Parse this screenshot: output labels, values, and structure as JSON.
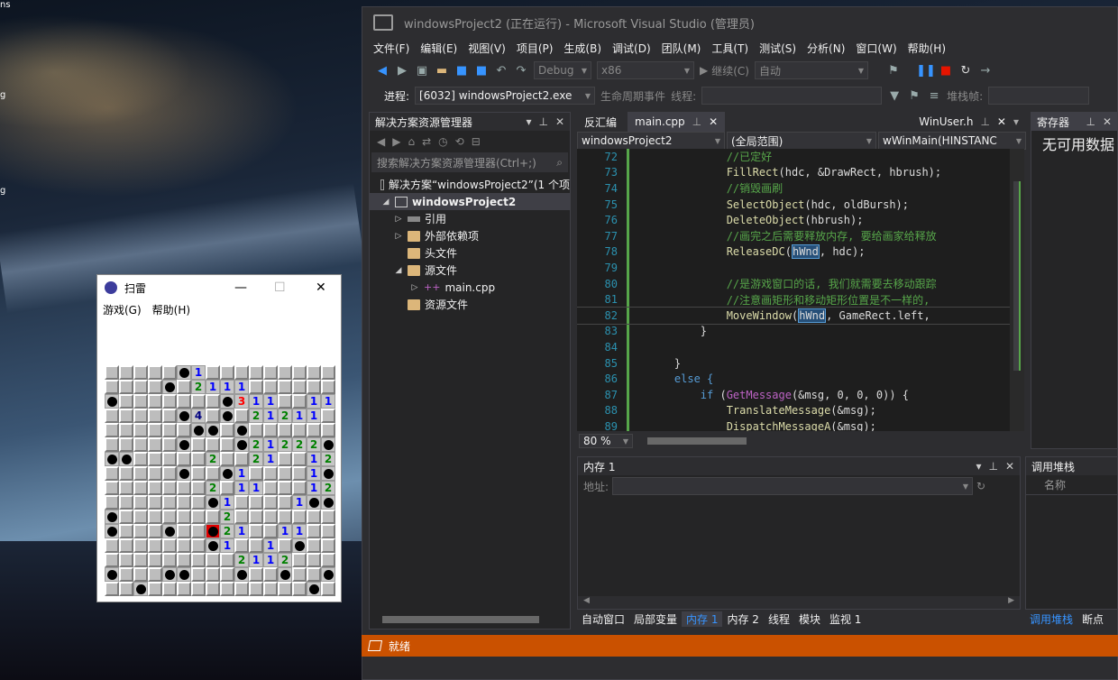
{
  "desktop": {
    "labels": [
      "ns",
      "ib",
      "g",
      "g"
    ]
  },
  "vs": {
    "title": "windowsProject2 (正在运行) - Microsoft Visual Studio (管理员)",
    "menu": [
      "文件(F)",
      "编辑(E)",
      "视图(V)",
      "项目(P)",
      "生成(B)",
      "调试(D)",
      "团队(M)",
      "工具(T)",
      "测试(S)",
      "分析(N)",
      "窗口(W)",
      "帮助(H)"
    ],
    "toolbar": {
      "config": "Debug",
      "platform": "x86",
      "continue": "继续(C)",
      "auto": "自动"
    },
    "toolbar2": {
      "process_label": "进程:",
      "process": "[6032] windowsProject2.exe",
      "lifecycle": "生命周期事件",
      "thread": "线程:",
      "stack": "堆栈帧:"
    },
    "solution_explorer": {
      "title": "解决方案资源管理器",
      "search_placeholder": "搜索解决方案资源管理器(Ctrl+;)",
      "items": [
        {
          "label": "解决方案“windowsProject2”(1 个项"
        },
        {
          "label": "windowsProject2"
        },
        {
          "label": "引用"
        },
        {
          "label": "外部依赖项"
        },
        {
          "label": "头文件"
        },
        {
          "label": "源文件"
        },
        {
          "label": "main.cpp"
        },
        {
          "label": "资源文件"
        }
      ]
    },
    "editor": {
      "tabs": [
        "反汇编",
        "main.cpp",
        "WinUser.h"
      ],
      "nav": [
        "windowsProject2",
        "(全局范围)",
        "wWinMain(HINSTANC"
      ],
      "zoom": "80 %",
      "lines": [
        {
          "n": "72",
          "t": "            //已定好"
        },
        {
          "n": "73",
          "t": "            FillRect(hdc, &DrawRect, hbrush);"
        },
        {
          "n": "74",
          "t": "            //销毁画刷"
        },
        {
          "n": "75",
          "t": "            SelectObject(hdc, oldBursh);"
        },
        {
          "n": "76",
          "t": "            DeleteObject(hbrush);"
        },
        {
          "n": "77",
          "t": "            //画完之后需要释放内存, 要给画家给释放"
        },
        {
          "n": "78",
          "t": "            ReleaseDC(hWnd, hdc);"
        },
        {
          "n": "79",
          "t": ""
        },
        {
          "n": "80",
          "t": "            //是游戏窗口的话, 我们就需要去移动跟踪"
        },
        {
          "n": "81",
          "t": "            //注意画矩形和移动矩形位置是不一样的,"
        },
        {
          "n": "82",
          "t": "            MoveWindow(hWnd, GameRect.left,"
        },
        {
          "n": "83",
          "t": "        }"
        },
        {
          "n": "84",
          "t": ""
        },
        {
          "n": "85",
          "t": "    }"
        },
        {
          "n": "86",
          "t": "    else {"
        },
        {
          "n": "87",
          "t": "        if (GetMessage(&msg, 0, 0, 0)) {"
        },
        {
          "n": "88",
          "t": "            TranslateMessage(&msg);"
        },
        {
          "n": "89",
          "t": "            DispatchMessageA(&msg);"
        }
      ]
    },
    "registers": {
      "title": "寄存器",
      "empty": "无可用数据"
    },
    "memory": {
      "title": "内存 1",
      "address_label": "地址:"
    },
    "callstack": {
      "title": "调用堆栈",
      "col": "名称"
    },
    "bottom_tabs": [
      "自动窗口",
      "局部变量",
      "内存 1",
      "内存 2",
      "线程",
      "模块",
      "监视 1"
    ],
    "bottom_tabs_right": [
      "调用堆栈",
      "断点"
    ],
    "status": "就绪"
  },
  "minesweeper": {
    "title": "扫雷",
    "menu": [
      "游戏(G)",
      "帮助(H)"
    ],
    "rows": [
      "_____m1_________",
      "____m_2111______",
      "m_______m311__11",
      "_____m4_m_21211_2m",
      "______mm_m______",
      "_____m___m21222m_",
      "mm_____2__21__123",
      "_____m__m1____1m",
      "_______2_11___1222",
      "_______m1____1mm_",
      "m_______2_______",
      "m___m__X21__11__",
      "_______m1__1_m__",
      "_________2112___",
      "m___mm___m__m__m_",
      "__m___________m__"
    ]
  }
}
